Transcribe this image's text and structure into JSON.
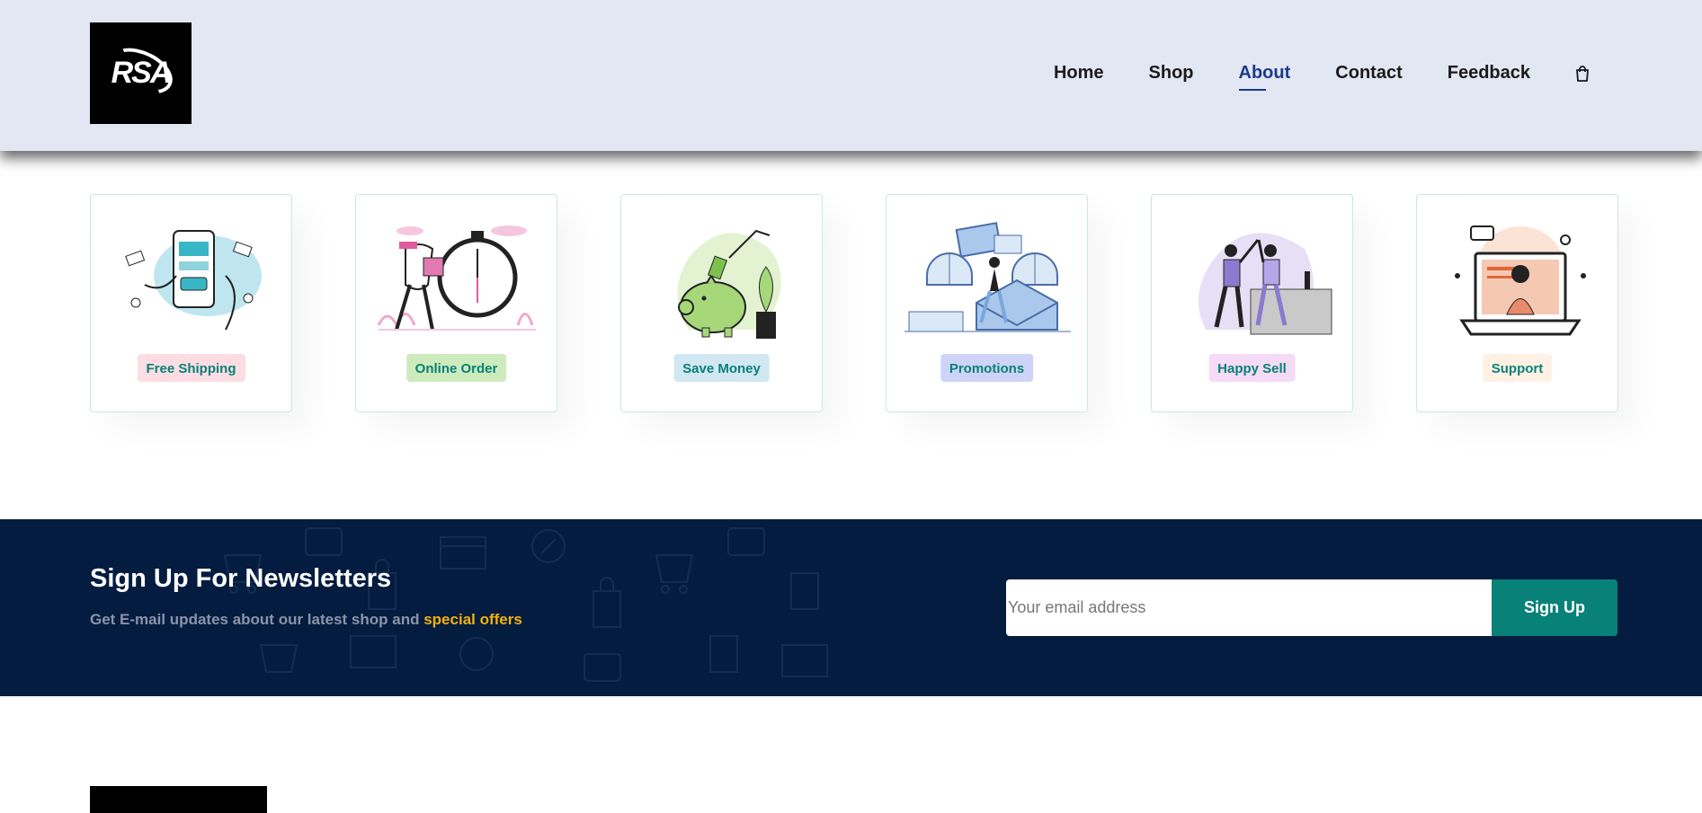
{
  "header": {
    "logo_text": "RSA",
    "nav": [
      {
        "label": "Home",
        "active": false
      },
      {
        "label": "Shop",
        "active": false
      },
      {
        "label": "About",
        "active": true
      },
      {
        "label": "Contact",
        "active": false
      },
      {
        "label": "Feedback",
        "active": false
      }
    ],
    "cart_icon": "shopping-bag-icon"
  },
  "features": [
    {
      "label": "Free Shipping",
      "bg": "#fddde4"
    },
    {
      "label": "Online Order",
      "bg": "#cdebbc"
    },
    {
      "label": "Save Money",
      "bg": "#d1e8f2"
    },
    {
      "label": "Promotions",
      "bg": "#cdd4f8"
    },
    {
      "label": "Happy Sell",
      "bg": "#f6dbf6"
    },
    {
      "label": "Support",
      "bg": "#fff2e5"
    }
  ],
  "newsletter": {
    "title": "Sign Up For Newsletters",
    "subtitle": "Get E-mail updates about our latest shop and ",
    "highlight": "special offers",
    "email_placeholder": "Your email address",
    "button_label": "Sign Up"
  },
  "colors": {
    "header_bg": "#e3e6f3",
    "accent": "#088178",
    "newsletter_bg": "#041c40",
    "highlight": "#f5b10b"
  }
}
